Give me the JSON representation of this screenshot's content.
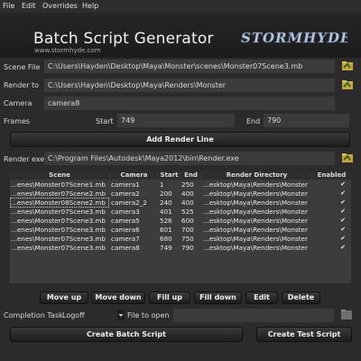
{
  "menu": [
    "File",
    "Edit",
    "Overrides",
    "Help"
  ],
  "app_title": "Batch Script Generator",
  "website": "www.stormhyde.com",
  "logo_text": "STORMHYDE",
  "scene_file": {
    "label": "Scene File",
    "value": "C:\\Users\\Hayden\\Desktop\\Maya\\Monster\\scenes\\Monster07Scene3.mb"
  },
  "render_to": {
    "label": "Render to",
    "value": "C:\\Users\\Hayden\\Desktop\\Maya\\Renders\\Monster"
  },
  "camera": {
    "label": "Camera",
    "value": "camera8"
  },
  "frames": {
    "label": "Frames",
    "start_label": "Start",
    "start": "749",
    "end_label": "End",
    "end": "790"
  },
  "add_render_line": "Add Render Line",
  "render_exe": {
    "label": "Render exe",
    "value": "C:\\Program Files\\Autodesk\\Maya2012\\bin\\Render.exe"
  },
  "table": {
    "headers": [
      "Scene",
      "Camera",
      "Start",
      "End",
      "Render Directory",
      "Enabled"
    ],
    "rows": [
      {
        "scene": "...enes\\Monster07Scene1.mb",
        "camera": "camera1",
        "start": "1",
        "end": "250",
        "dir": "...esktop\\Maya\\Renders\\Monster",
        "enabled": "✔"
      },
      {
        "scene": "...enes\\Monster07Scene2.mb",
        "camera": "camera2",
        "start": "200",
        "end": "400",
        "dir": "...esktop\\Maya\\Renders\\Monster",
        "enabled": "✔"
      },
      {
        "scene": "...enes\\Monster08Scene2.mb",
        "camera": "camera2_2",
        "start": "240",
        "end": "400",
        "dir": "...esktop\\Maya\\Renders\\Monster",
        "enabled": "✔"
      },
      {
        "scene": "...enes\\Monster07Scene3.mb",
        "camera": "camera3",
        "start": "401",
        "end": "525",
        "dir": "...esktop\\Maya\\Renders\\Monster",
        "enabled": "✔"
      },
      {
        "scene": "...enes\\Monster07Scene3.mb",
        "camera": "camera5",
        "start": "526",
        "end": "600",
        "dir": "...esktop\\Maya\\Renders\\Monster",
        "enabled": "✔"
      },
      {
        "scene": "...enes\\Monster07Scene3.mb",
        "camera": "camera6",
        "start": "601",
        "end": "700",
        "dir": "...esktop\\Maya\\Renders\\Monster",
        "enabled": "✔"
      },
      {
        "scene": "...enes\\Monster07Scene3.mb",
        "camera": "camera7",
        "start": "680",
        "end": "750",
        "dir": "...esktop\\Maya\\Renders\\Monster",
        "enabled": "✔"
      },
      {
        "scene": "...enes\\Monster07Scene3.mb",
        "camera": "camera8",
        "start": "749",
        "end": "790",
        "dir": "...esktop\\Maya\\Renders\\Monster",
        "enabled": "✔"
      }
    ]
  },
  "buttons": {
    "move_up": "Move up",
    "move_down": "Move down",
    "fill_up": "Fill up",
    "fill_down": "Fill down",
    "edit": "Edit",
    "delete": "Delete"
  },
  "completion": {
    "label": "Completion Task",
    "value": "Logoff",
    "file_label": "File to open"
  },
  "create_batch": "Create Batch Script",
  "create_test": "Create Test Script"
}
